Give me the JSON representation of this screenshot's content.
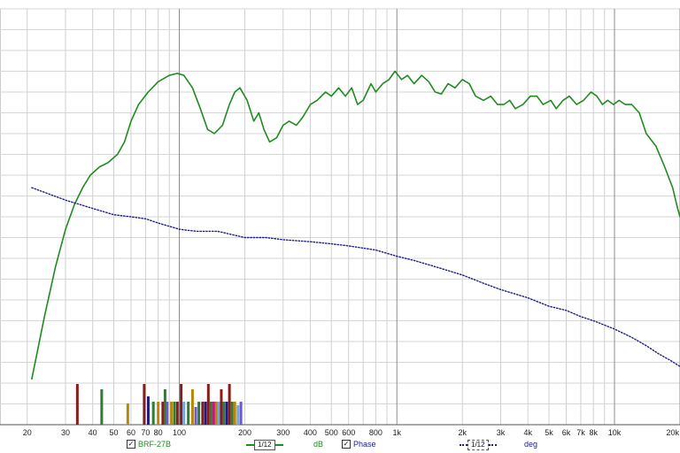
{
  "chart_data": {
    "type": "line",
    "x_scale": "log",
    "xlim": [
      15,
      20000
    ],
    "ylim": [
      0,
      100
    ],
    "grid": true,
    "x_tick_labels": [
      {
        "x": 20,
        "label": "20"
      },
      {
        "x": 30,
        "label": "30"
      },
      {
        "x": 40,
        "label": "40"
      },
      {
        "x": 50,
        "label": "50"
      },
      {
        "x": 60,
        "label": "60"
      },
      {
        "x": 70,
        "label": "70"
      },
      {
        "x": 80,
        "label": "80"
      },
      {
        "x": 100,
        "label": "100"
      },
      {
        "x": 200,
        "label": "200"
      },
      {
        "x": 300,
        "label": "300"
      },
      {
        "x": 400,
        "label": "400"
      },
      {
        "x": 500,
        "label": "500"
      },
      {
        "x": 600,
        "label": "600"
      },
      {
        "x": 800,
        "label": "800"
      },
      {
        "x": 1000,
        "label": "1k"
      },
      {
        "x": 2000,
        "label": "2k"
      },
      {
        "x": 3000,
        "label": "3k"
      },
      {
        "x": 4000,
        "label": "4k"
      },
      {
        "x": 5000,
        "label": "5k"
      },
      {
        "x": 6000,
        "label": "6k"
      },
      {
        "x": 7000,
        "label": "7k"
      },
      {
        "x": 8000,
        "label": "8k"
      },
      {
        "x": 10000,
        "label": "10k"
      },
      {
        "x": 20000,
        "label": "20k"
      }
    ],
    "series": [
      {
        "name": "BRF-27B",
        "unit": "dB",
        "color": "#1f8c1f",
        "points": [
          [
            21,
            11
          ],
          [
            24,
            26
          ],
          [
            27,
            38
          ],
          [
            30,
            47
          ],
          [
            33,
            53
          ],
          [
            36,
            57
          ],
          [
            39,
            60
          ],
          [
            43,
            62
          ],
          [
            47,
            63
          ],
          [
            52,
            65
          ],
          [
            56,
            68
          ],
          [
            60,
            73
          ],
          [
            65,
            77
          ],
          [
            72,
            80
          ],
          [
            80,
            82.5
          ],
          [
            90,
            84
          ],
          [
            98,
            84.5
          ],
          [
            105,
            84
          ],
          [
            115,
            81
          ],
          [
            125,
            76
          ],
          [
            135,
            71
          ],
          [
            145,
            70
          ],
          [
            158,
            72
          ],
          [
            170,
            77
          ],
          [
            180,
            80
          ],
          [
            190,
            81
          ],
          [
            205,
            78
          ],
          [
            220,
            73
          ],
          [
            232,
            75
          ],
          [
            245,
            71
          ],
          [
            260,
            68
          ],
          [
            280,
            69
          ],
          [
            300,
            72
          ],
          [
            320,
            73
          ],
          [
            345,
            72
          ],
          [
            370,
            74
          ],
          [
            400,
            77
          ],
          [
            430,
            78
          ],
          [
            470,
            80
          ],
          [
            500,
            79
          ],
          [
            540,
            81
          ],
          [
            580,
            79
          ],
          [
            620,
            81
          ],
          [
            660,
            77
          ],
          [
            700,
            78
          ],
          [
            760,
            82
          ],
          [
            800,
            80
          ],
          [
            860,
            82
          ],
          [
            920,
            83
          ],
          [
            980,
            85
          ],
          [
            1050,
            83
          ],
          [
            1120,
            84
          ],
          [
            1200,
            82
          ],
          [
            1300,
            84
          ],
          [
            1400,
            82.5
          ],
          [
            1500,
            80
          ],
          [
            1600,
            79.5
          ],
          [
            1720,
            82
          ],
          [
            1850,
            81
          ],
          [
            2000,
            83
          ],
          [
            2150,
            82
          ],
          [
            2300,
            79
          ],
          [
            2500,
            78
          ],
          [
            2700,
            79
          ],
          [
            2900,
            77
          ],
          [
            3100,
            77
          ],
          [
            3300,
            78
          ],
          [
            3500,
            76
          ],
          [
            3800,
            77
          ],
          [
            4100,
            79
          ],
          [
            4400,
            79
          ],
          [
            4700,
            77
          ],
          [
            5100,
            78
          ],
          [
            5400,
            76
          ],
          [
            5800,
            78
          ],
          [
            6200,
            79
          ],
          [
            6700,
            77
          ],
          [
            7200,
            78
          ],
          [
            7800,
            80
          ],
          [
            8300,
            79
          ],
          [
            8800,
            77
          ],
          [
            9300,
            78
          ],
          [
            9900,
            77
          ],
          [
            10500,
            78
          ],
          [
            11200,
            77
          ],
          [
            12000,
            77
          ],
          [
            13000,
            75
          ],
          [
            14000,
            70
          ],
          [
            15500,
            67
          ],
          [
            17000,
            62
          ],
          [
            18500,
            57
          ],
          [
            19500,
            52
          ],
          [
            20000,
            50
          ]
        ]
      },
      {
        "name": "Phase",
        "unit": "deg",
        "color": "#1c1c8c",
        "points": [
          [
            21,
            57
          ],
          [
            30,
            54
          ],
          [
            40,
            52
          ],
          [
            50,
            50.5
          ],
          [
            60,
            50
          ],
          [
            70,
            49.5
          ],
          [
            80,
            48.5
          ],
          [
            100,
            47
          ],
          [
            120,
            46.5
          ],
          [
            150,
            46.5
          ],
          [
            200,
            45
          ],
          [
            250,
            45
          ],
          [
            300,
            44.5
          ],
          [
            400,
            44
          ],
          [
            500,
            43.5
          ],
          [
            600,
            43
          ],
          [
            800,
            42
          ],
          [
            1000,
            40.5
          ],
          [
            1200,
            39.5
          ],
          [
            1500,
            38
          ],
          [
            2000,
            36
          ],
          [
            2500,
            34
          ],
          [
            3000,
            32.5
          ],
          [
            4000,
            30.5
          ],
          [
            5000,
            28.5
          ],
          [
            6000,
            27.5
          ],
          [
            7000,
            26
          ],
          [
            8000,
            25
          ],
          [
            10000,
            23
          ],
          [
            12000,
            21
          ],
          [
            14000,
            19
          ],
          [
            16000,
            17
          ],
          [
            18000,
            15.5
          ],
          [
            20000,
            14
          ]
        ]
      }
    ],
    "markers": [
      {
        "x": 34,
        "h": 46,
        "c": "#8b1a1a"
      },
      {
        "x": 44,
        "h": 40,
        "c": "#2e7d32"
      },
      {
        "x": 58,
        "h": 24,
        "c": "#b8860b"
      },
      {
        "x": 69,
        "h": 46,
        "c": "#8b1a1a"
      },
      {
        "x": 72,
        "h": 32,
        "c": "#1a1a8b"
      },
      {
        "x": 76,
        "h": 26,
        "c": "#2e7d32"
      },
      {
        "x": 80,
        "h": 26,
        "c": "#b8860b"
      },
      {
        "x": 84,
        "h": 26,
        "c": "#8b1a1a"
      },
      {
        "x": 86,
        "h": 40,
        "c": "#2e7d32"
      },
      {
        "x": 88,
        "h": 26,
        "c": "#6a5acd"
      },
      {
        "x": 92,
        "h": 26,
        "c": "#b8860b"
      },
      {
        "x": 95,
        "h": 26,
        "c": "#2e7d32"
      },
      {
        "x": 98,
        "h": 26,
        "c": "#8b1a1a"
      },
      {
        "x": 102,
        "h": 46,
        "c": "#8b1a1a"
      },
      {
        "x": 105,
        "h": 26,
        "c": "#6fa8dc"
      },
      {
        "x": 110,
        "h": 26,
        "c": "#2e7d32"
      },
      {
        "x": 115,
        "h": 40,
        "c": "#b8860b"
      },
      {
        "x": 119,
        "h": 20,
        "c": "#6a5acd"
      },
      {
        "x": 123,
        "h": 26,
        "c": "#2e7d32"
      },
      {
        "x": 128,
        "h": 26,
        "c": "#8b1a1a"
      },
      {
        "x": 132,
        "h": 26,
        "c": "#1a1a8b"
      },
      {
        "x": 136,
        "h": 46,
        "c": "#8b1a1a"
      },
      {
        "x": 140,
        "h": 26,
        "c": "#2e7d32"
      },
      {
        "x": 144,
        "h": 26,
        "c": "#c71585"
      },
      {
        "x": 148,
        "h": 26,
        "c": "#b8860b"
      },
      {
        "x": 152,
        "h": 26,
        "c": "#6fa8dc"
      },
      {
        "x": 156,
        "h": 40,
        "c": "#8b1a1a"
      },
      {
        "x": 160,
        "h": 26,
        "c": "#2e7d32"
      },
      {
        "x": 165,
        "h": 26,
        "c": "#1a1a8b"
      },
      {
        "x": 170,
        "h": 46,
        "c": "#8b1a1a"
      },
      {
        "x": 175,
        "h": 26,
        "c": "#2e7d32"
      },
      {
        "x": 180,
        "h": 26,
        "c": "#b8860b"
      },
      {
        "x": 186,
        "h": 22,
        "c": "#6fa8dc"
      },
      {
        "x": 192,
        "h": 26,
        "c": "#6a5acd"
      }
    ]
  },
  "legend": {
    "series1_name": "BRF-27B",
    "series1_unit": "dB",
    "smoothing": "1/12",
    "series2_name": "Phase",
    "series2_unit": "deg",
    "check_mark": "✓",
    "series1_color": "#1f8c1f",
    "series2_color": "#1c1c8c"
  }
}
